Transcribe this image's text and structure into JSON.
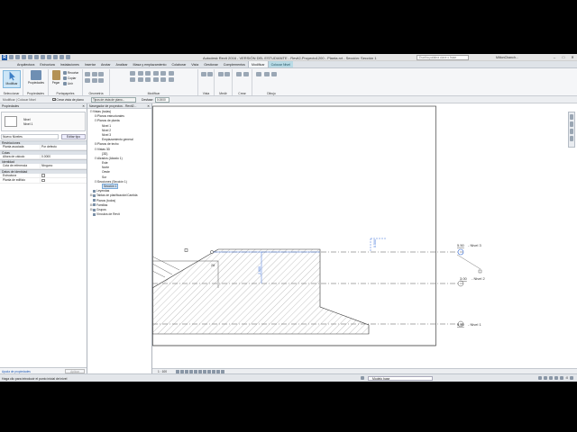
{
  "app": {
    "logo": "R",
    "title": "Autodesk Revit 2016 - VERSIÓN DEL ESTUDIANTE -     Revit2-Proyecto1200 - Planta.rvt - Sección: Sección 1",
    "search_placeholder": "Escriba palabra clave o frase",
    "user": "MiltonChanch...",
    "window_buttons": [
      "–",
      "□",
      "✕"
    ]
  },
  "ribbon_tabs": [
    {
      "label": "Arquitectura",
      "state": "normal"
    },
    {
      "label": "Estructura",
      "state": "normal"
    },
    {
      "label": "Instalaciones",
      "state": "normal"
    },
    {
      "label": "Insertar",
      "state": "normal"
    },
    {
      "label": "Anotar",
      "state": "normal"
    },
    {
      "label": "Analizar",
      "state": "normal"
    },
    {
      "label": "Masa y emplazamiento",
      "state": "normal"
    },
    {
      "label": "Colaborar",
      "state": "normal"
    },
    {
      "label": "Vista",
      "state": "normal"
    },
    {
      "label": "Gestionar",
      "state": "normal"
    },
    {
      "label": "Complementos",
      "state": "normal"
    },
    {
      "label": "Modificar",
      "state": "active"
    },
    {
      "label": "Colocar Nivel",
      "state": "context"
    }
  ],
  "ribbon": {
    "modify_label": "Modificar",
    "properties_label": "Propiedades",
    "paste_label": "Pegar",
    "clipboard_small": [
      "Recortar",
      "Copiar",
      "Unir"
    ],
    "groups": [
      "Seleccionar",
      "Propiedades",
      "Portapapeles",
      "Geometría",
      "Modificar",
      "Vista",
      "Medir",
      "Crear",
      "Dibujo"
    ]
  },
  "options_bar": {
    "context_label": "Modificar | Colocar Nivel",
    "checkbox_label": "Crear vista de plano",
    "type_button": "Tipos de vista de plano...",
    "offset_label": "Desfase:",
    "offset_value": "0.0000"
  },
  "properties": {
    "title": "Propiedades",
    "close": "✕",
    "type_name": "Nivel",
    "type_sub": "Nivel 1",
    "instance_select": "Nuevo Niveles",
    "edit_type": "Editar tipo",
    "sections": [
      {
        "name": "Restricciones",
        "rows": [
          {
            "k": "Planta asociada",
            "v": "Por defecto"
          }
        ]
      },
      {
        "name": "Cotas",
        "rows": [
          {
            "k": "Altura de cálculo",
            "v": "0.0000"
          }
        ]
      },
      {
        "name": "Identidad",
        "rows": [
          {
            "k": "Cota de referencia",
            "v": "Ninguno"
          }
        ]
      },
      {
        "name": "Datos de identidad",
        "rows": [
          {
            "k": "Estructura",
            "v": ""
          },
          {
            "k": "Planta de edificio",
            "v": ""
          }
        ]
      }
    ],
    "help_link": "Ayuda de propiedades",
    "apply": "Aplicar"
  },
  "browser": {
    "title": "Navegador de proyectos - Revit2...",
    "close": "✕",
    "nodes": [
      {
        "label": "Vistas (todas)",
        "indent": 0,
        "exp": "⊟"
      },
      {
        "label": "Planos estructurales",
        "indent": 1,
        "exp": "⊞"
      },
      {
        "label": "Planos de planta",
        "indent": 1,
        "exp": "⊟"
      },
      {
        "label": "Nivel 1",
        "indent": 2,
        "exp": ""
      },
      {
        "label": "Nivel 2",
        "indent": 2,
        "exp": ""
      },
      {
        "label": "Nivel 3",
        "indent": 2,
        "exp": ""
      },
      {
        "label": "Emplazamiento general",
        "indent": 2,
        "exp": ""
      },
      {
        "label": "Planos de techo",
        "indent": 1,
        "exp": "⊞"
      },
      {
        "label": "Vistas 3D",
        "indent": 1,
        "exp": "⊟"
      },
      {
        "label": "{3D}",
        "indent": 2,
        "exp": ""
      },
      {
        "label": "Alzados (Alzado 1)",
        "indent": 1,
        "exp": "⊟"
      },
      {
        "label": "Este",
        "indent": 2,
        "exp": ""
      },
      {
        "label": "Norte",
        "indent": 2,
        "exp": ""
      },
      {
        "label": "Oeste",
        "indent": 2,
        "exp": ""
      },
      {
        "label": "Sur",
        "indent": 2,
        "exp": ""
      },
      {
        "label": "Secciones (Sección 1)",
        "indent": 1,
        "exp": "⊟"
      },
      {
        "label": "Sección 1",
        "indent": 2,
        "exp": "",
        "selected": true
      },
      {
        "label": "Leyendas",
        "indent": 0,
        "exp": "",
        "icon": true
      },
      {
        "label": "Tablas de planificación/Cantida",
        "indent": 0,
        "exp": "⊞",
        "icon": true
      },
      {
        "label": "Planos (todos)",
        "indent": 0,
        "exp": "",
        "icon": true
      },
      {
        "label": "Familias",
        "indent": 0,
        "exp": "⊞",
        "icon": true
      },
      {
        "label": "Grupos",
        "indent": 0,
        "exp": "⊞",
        "icon": true
      },
      {
        "label": "Vínculos de Revit",
        "indent": 0,
        "exp": "",
        "icon": true
      }
    ]
  },
  "canvas": {
    "levels": [
      {
        "name": "Nivel 3",
        "elevation": "5.50"
      },
      {
        "name": "Nivel 2",
        "elevation": "3.00"
      },
      {
        "name": "Nivel 1",
        "elevation": "0.40"
      }
    ],
    "temp_dims": [
      "0.500",
      "2.000"
    ],
    "marker": "28"
  },
  "view_control": {
    "scale": "1 : 100"
  },
  "status": {
    "message": "Haga clic para introducir el punto inicial del nivel",
    "model_dropdown": "Modelo base",
    "zero": ":0"
  },
  "colors": {
    "accent": "#1f5aa8",
    "context_tab": "#b9dbe6",
    "selection": "#cfe3f7"
  }
}
